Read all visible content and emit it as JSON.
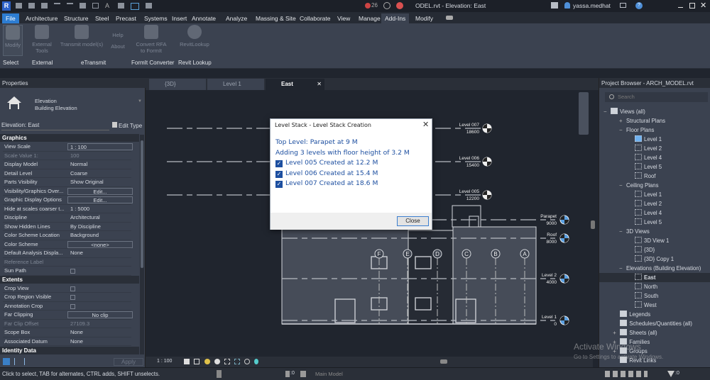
{
  "titlebar": {
    "title": "ODEL.rvt - Elevation: East",
    "user": "yassa.medhat",
    "badge_count": "26",
    "app_icon": "R"
  },
  "ribbon_tabs": [
    "File",
    "Architecture",
    "Structure",
    "Steel",
    "Precast",
    "Systems",
    "Insert",
    "Annotate",
    "Analyze",
    "Massing & Site",
    "Collaborate",
    "View",
    "Manage",
    "Add-Ins",
    "Modify"
  ],
  "active_tab": "Add-Ins",
  "ribbon": {
    "buttons": [
      {
        "label": "Modify"
      },
      {
        "label": "External Tools"
      },
      {
        "label": "Transmit model(s)"
      },
      {
        "label": "Help"
      },
      {
        "label": "About"
      },
      {
        "label": "Convert RFA to FormIt"
      },
      {
        "label": "RevitLookup"
      }
    ],
    "panels": [
      "Select",
      "External",
      "eTransmit",
      "FormIt Converter",
      "Revit Lookup"
    ]
  },
  "properties": {
    "title": "Properties",
    "type_name": "Elevation",
    "type_sub": "Building Elevation",
    "instance": "Elevation: East",
    "edit_type": "Edit Type",
    "sections": {
      "graphics": "Graphics",
      "extents": "Extents",
      "identity": "Identity Data"
    },
    "graphics_rows": [
      {
        "k": "View Scale",
        "v": "1 : 100",
        "t": "box-left"
      },
      {
        "k": "Scale Value    1:",
        "v": "100",
        "t": "dim"
      },
      {
        "k": "Display Model",
        "v": "Normal"
      },
      {
        "k": "Detail Level",
        "v": "Coarse"
      },
      {
        "k": "Parts Visibility",
        "v": "Show Original"
      },
      {
        "k": "Visibility/Graphics Over...",
        "v": "Edit...",
        "t": "box"
      },
      {
        "k": "Graphic Display Options",
        "v": "Edit...",
        "t": "box"
      },
      {
        "k": "Hide at scales coarser t...",
        "v": "1 : 5000"
      },
      {
        "k": "Discipline",
        "v": "Architectural"
      },
      {
        "k": "Show Hidden Lines",
        "v": "By Discipline"
      },
      {
        "k": "Color Scheme Location",
        "v": "Background"
      },
      {
        "k": "Color Scheme",
        "v": "<none>",
        "t": "box"
      },
      {
        "k": "Default Analysis Displa...",
        "v": "None"
      },
      {
        "k": "Reference Label",
        "v": "",
        "t": "dim"
      },
      {
        "k": "Sun Path",
        "v": "",
        "t": "cb"
      }
    ],
    "extents_rows": [
      {
        "k": "Crop View",
        "v": "",
        "t": "cb"
      },
      {
        "k": "Crop Region Visible",
        "v": "",
        "t": "cb"
      },
      {
        "k": "Annotation Crop",
        "v": "",
        "t": "cb"
      },
      {
        "k": "Far Clipping",
        "v": "No clip",
        "t": "box"
      },
      {
        "k": "Far Clip Offset",
        "v": "27109.3",
        "t": "dim"
      },
      {
        "k": "Scope Box",
        "v": "None"
      },
      {
        "k": "Associated Datum",
        "v": "None"
      }
    ],
    "apply": "Apply"
  },
  "view_tabs": [
    {
      "label": "{3D}"
    },
    {
      "label": "Level 1"
    },
    {
      "label": "East"
    }
  ],
  "levels": [
    {
      "name": "Level 007",
      "elev": "18600",
      "new": true
    },
    {
      "name": "Level 006",
      "elev": "15400",
      "new": true
    },
    {
      "name": "Level 005",
      "elev": "12200",
      "new": true
    },
    {
      "name": "Parapet",
      "elev": "9000"
    },
    {
      "name": "Roof",
      "elev": "8000"
    },
    {
      "name": "Level 2",
      "elev": "4000"
    },
    {
      "name": "Level 1",
      "elev": "0"
    }
  ],
  "grids": [
    "F",
    "E",
    "D",
    "C",
    "B",
    "A"
  ],
  "dialog": {
    "title": "Level Stack - Level Stack Creation",
    "line1": "Top Level: Parapet at 9 M",
    "line2": "Adding 3 levels with floor height of 3.2 M",
    "items": [
      "Level 005 Created at 12.2 M",
      "Level 006 Created at 15.4 M",
      "Level 007 Created at 18.6 M"
    ],
    "close": "Close"
  },
  "browser": {
    "title": "Project Browser - ARCH_MODEL.rvt",
    "search_placeholder": "Search",
    "items": [
      {
        "l": "Views (all)",
        "d": 0,
        "e": "−"
      },
      {
        "l": "Structural Plans",
        "d": 1,
        "e": "+"
      },
      {
        "l": "Floor Plans",
        "d": 1,
        "e": "−"
      },
      {
        "l": "Level 1",
        "d": 2,
        "v": 1,
        "sel": 1
      },
      {
        "l": "Level 2",
        "d": 2,
        "v": 1
      },
      {
        "l": "Level 4",
        "d": 2,
        "v": 1
      },
      {
        "l": "Level 5",
        "d": 2,
        "v": 1
      },
      {
        "l": "Roof",
        "d": 2,
        "v": 1
      },
      {
        "l": "Ceiling Plans",
        "d": 1,
        "e": "−"
      },
      {
        "l": "Level 1",
        "d": 2,
        "v": 1
      },
      {
        "l": "Level 2",
        "d": 2,
        "v": 1
      },
      {
        "l": "Level 4",
        "d": 2,
        "v": 1
      },
      {
        "l": "Level 5",
        "d": 2,
        "v": 1
      },
      {
        "l": "3D Views",
        "d": 1,
        "e": "−"
      },
      {
        "l": "3D View 1",
        "d": 2,
        "v": 1
      },
      {
        "l": "{3D}",
        "d": 2,
        "v": 1
      },
      {
        "l": "{3D} Copy 1",
        "d": 2,
        "v": 1
      },
      {
        "l": "Elevations (Building Elevation)",
        "d": 1,
        "e": "−"
      },
      {
        "l": "East",
        "d": 2,
        "v": 1,
        "cur": 1
      },
      {
        "l": "North",
        "d": 2,
        "v": 1
      },
      {
        "l": "South",
        "d": 2,
        "v": 1
      },
      {
        "l": "West",
        "d": 2,
        "v": 1
      },
      {
        "l": "Legends",
        "d": 0.6
      },
      {
        "l": "Schedules/Quantities (all)",
        "d": 0.6
      },
      {
        "l": "Sheets (all)",
        "d": 0.6,
        "e": "+"
      },
      {
        "l": "Families",
        "d": 0.6,
        "e": "+"
      },
      {
        "l": "Groups",
        "d": 0.6,
        "e": "+"
      },
      {
        "l": "Revit Links",
        "d": 0.6
      }
    ]
  },
  "viewbar": {
    "scale": "1 : 100"
  },
  "status": {
    "hint": "Click to select, TAB for alternates, CTRL adds, SHIFT unselects.",
    "workset": "Main Model",
    "count_a": ":0",
    "count_b": ":0"
  },
  "watermark": {
    "line1": "Activate Windows",
    "line2": "Go to Settings to activate Windows."
  },
  "colors": {
    "accent": "#2d7dd2",
    "dialog_text": "#1d4fa0",
    "panel": "#3b4250",
    "canvas": "#20252e"
  }
}
